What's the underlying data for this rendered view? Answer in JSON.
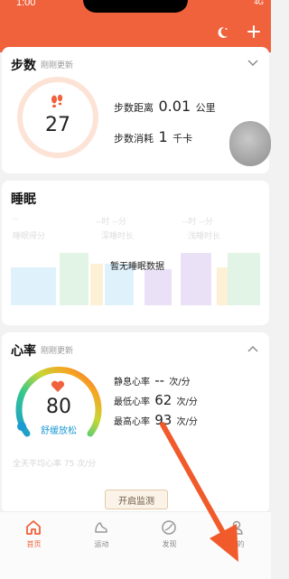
{
  "status": {
    "time": "1:00",
    "network": "4G"
  },
  "header": {
    "bg": "#f0623c",
    "icons": [
      "moon-icon",
      "plus-icon"
    ]
  },
  "steps": {
    "title": "步数",
    "subtitle": "刚刚更新",
    "count": "27",
    "distance_label": "步数距离",
    "distance_value": "0.01",
    "distance_unit": "公里",
    "calorie_label": "步数消耗",
    "calorie_value": "1",
    "calorie_unit": "千卡"
  },
  "sleep": {
    "title": "睡眠",
    "empty_text": "暂无睡眠数据",
    "faded": [
      "--",
      "睡眠得分",
      "--时 --分",
      "深睡时长",
      "--时 --分",
      "浅睡时长"
    ]
  },
  "heart": {
    "title": "心率",
    "subtitle": "刚刚更新",
    "value": "80",
    "state": "舒缓放松",
    "rest_label": "静息心率",
    "rest_value": "--",
    "rest_unit": "次/分",
    "min_label": "最低心率",
    "min_value": "62",
    "min_unit": "次/分",
    "max_label": "最高心率",
    "max_value": "93",
    "max_unit": "次/分",
    "avg_text": "全天平均心率 75 次/分",
    "button": "开启监测"
  },
  "nav": {
    "items": [
      {
        "label": "首页",
        "icon": "home-icon",
        "active": true
      },
      {
        "label": "运动",
        "icon": "shoe-icon",
        "active": false
      },
      {
        "label": "发现",
        "icon": "discover-icon",
        "active": false
      },
      {
        "label": "我的",
        "icon": "profile-icon",
        "active": false
      }
    ]
  },
  "colors": {
    "accent": "#f0623c",
    "heart_state": "#1c9ad4"
  }
}
